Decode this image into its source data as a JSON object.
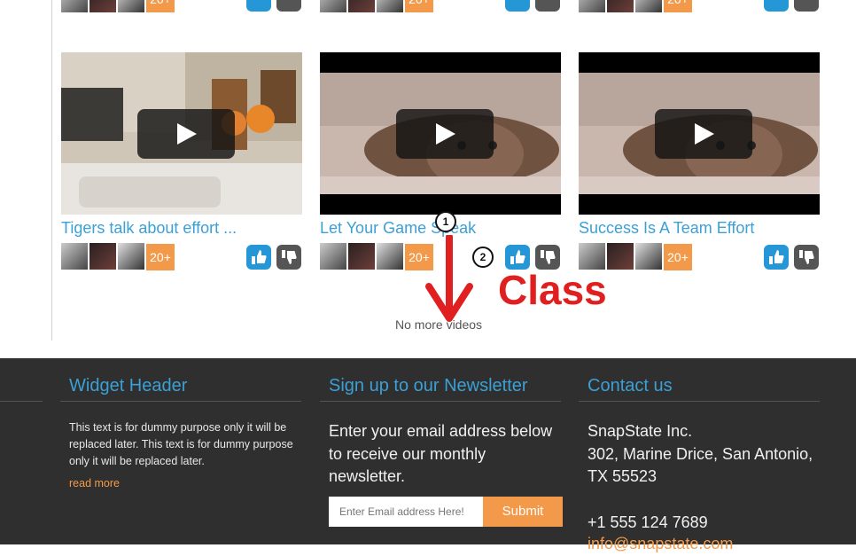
{
  "videos_top_row": [
    {
      "badge": "20+"
    },
    {
      "badge": "20+"
    },
    {
      "badge": "20+"
    }
  ],
  "videos": [
    {
      "title": "Tigers talk about effort ...",
      "badge": "20+"
    },
    {
      "title": "Let Your Game Speak",
      "badge": "20+"
    },
    {
      "title": "Success Is A Team Effort",
      "badge": "20+"
    }
  ],
  "end_message": "No more videos",
  "annotations": {
    "marker_1": "1",
    "marker_2": "2",
    "callout": "Class"
  },
  "footer": {
    "widget": {
      "title": "Widget Header",
      "text": "This text is for dummy purpose only it will be replaced later. This text is for dummy purpose only it will be replaced later.",
      "read_more": "read more"
    },
    "newsletter": {
      "title": "Sign up to our Newsletter",
      "text": "Enter your email address below to receive our monthly newsletter.",
      "placeholder": "Enter Email address Here!",
      "submit": "Submit"
    },
    "contact": {
      "title": "Contact us",
      "company": "SnapState Inc.",
      "address1": "302, Marine Drice, San Antonio,",
      "address2": "TX 55523",
      "phone": "+1 555 124 7689",
      "email": "info@snapstate.com"
    }
  },
  "colors": {
    "accent_blue": "#3ba0d6",
    "badge_orange": "#f39a4a",
    "like_blue": "#2596d6",
    "dislike_gray": "#555555",
    "footer_bg": "#2f2f2f",
    "annotation_red": "#e02020"
  }
}
